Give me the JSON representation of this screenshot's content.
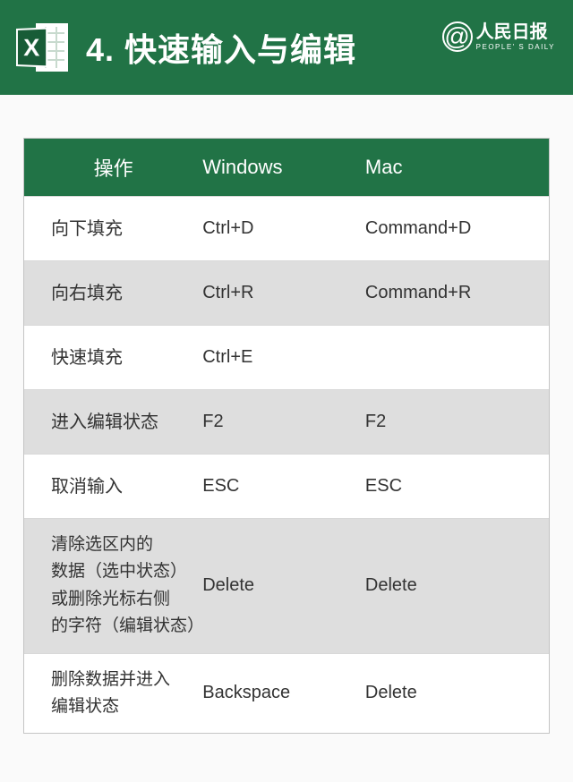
{
  "header": {
    "title": "4. 快速输入与编辑",
    "icon_letter": "X",
    "brand_cn": "人民日报",
    "brand_en": "PEOPLE' S DAILY",
    "brand_at": "@"
  },
  "table": {
    "headers": {
      "op": "操作",
      "win": "Windows",
      "mac": "Mac"
    },
    "rows": [
      {
        "op": "向下填充",
        "win": "Ctrl+D",
        "mac": "Command+D",
        "alt": false,
        "tall": false
      },
      {
        "op": "向右填充",
        "win": "Ctrl+R",
        "mac": "Command+R",
        "alt": true,
        "tall": false
      },
      {
        "op": "快速填充",
        "win": "Ctrl+E",
        "mac": "",
        "alt": false,
        "tall": false
      },
      {
        "op": "进入编辑状态",
        "win": "F2",
        "mac": "F2",
        "alt": true,
        "tall": false
      },
      {
        "op": "取消输入",
        "win": "ESC",
        "mac": "ESC",
        "alt": false,
        "tall": false
      },
      {
        "op": "清除选区内的\n数据（选中状态）\n或删除光标右侧\n的字符（编辑状态）",
        "win": "Delete",
        "mac": "Delete",
        "alt": true,
        "tall": true
      },
      {
        "op": "删除数据并进入\n编辑状态",
        "win": "Backspace",
        "mac": "Delete",
        "alt": false,
        "tall": true
      }
    ]
  }
}
